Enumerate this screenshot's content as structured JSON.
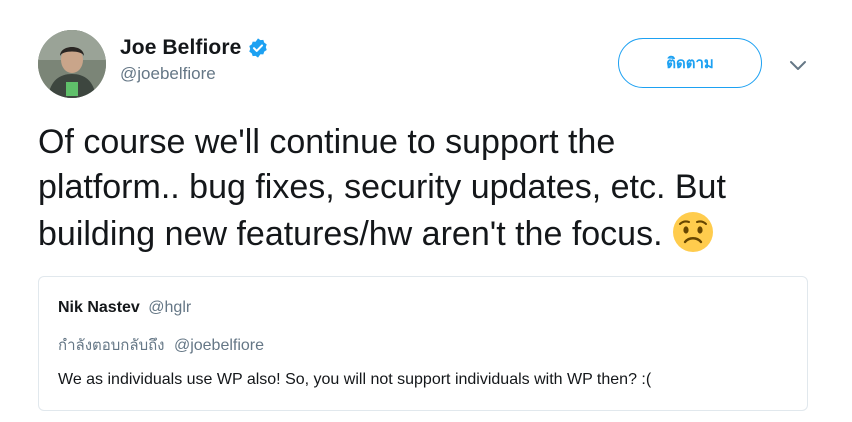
{
  "author": {
    "display_name": "Joe Belfiore",
    "handle": "@joebelfiore",
    "verified": true,
    "avatar_icon": "profile-photo"
  },
  "actions": {
    "follow_label": "ติดตาม",
    "menu_icon": "chevron-down-icon"
  },
  "tweet": {
    "lines": [
      "Of course we'll continue to support the",
      "platform.. bug fixes, security updates, etc. But",
      "building new features/hw aren't the focus."
    ],
    "emoji": "worried-face"
  },
  "quoted_tweet": {
    "name": "Nik Nastev",
    "handle": "@hglr",
    "reply_label": "กำลังตอบกลับถึง",
    "reply_to": "@joebelfiore",
    "text": "We as individuals use WP also! So, you will not support individuals with WP then? :("
  },
  "colors": {
    "accent": "#1da1f2",
    "text": "#14171a",
    "muted": "#657786",
    "border": "#e1e8ed"
  }
}
